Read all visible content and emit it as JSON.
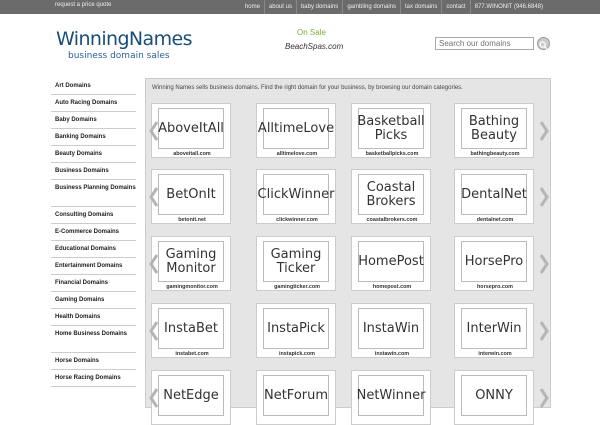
{
  "topbar": {
    "quote": "request a price quote",
    "nav": [
      "home",
      "about us",
      "baby domains",
      "gambling domains",
      "tax domains",
      "contact",
      "877.WINONIT (946.6848)"
    ]
  },
  "logo": {
    "name": "WinningNames",
    "tagline": "business domain sales"
  },
  "on_sale": {
    "label": "On Sale",
    "domain": "BeachSpas.com"
  },
  "search": {
    "placeholder": "Search our domains",
    "icon": "search-icon"
  },
  "sidebar": {
    "items": [
      "Art Domains",
      "Auto Racing Domains",
      "Baby Domains",
      "Banking Domains",
      "Beauty Domains",
      "Business Domains",
      "Business Planning Domains",
      "Consulting Domains",
      "E-Commerce Domains",
      "Educational Domains",
      "Entertainment Domains",
      "Financial Domains",
      "Gaming Domains",
      "Health Domains",
      "Home Business Domains",
      "Horse Domains",
      "Horse Racing Domains"
    ]
  },
  "intro": "Winning Names sells business domains. Find the right domain for your business, by browsing our domain categories.",
  "rows": [
    [
      {
        "logo": [
          "AboveItAll"
        ],
        "domain": "aboveitall.com"
      },
      {
        "logo": [
          "AlltimeLove"
        ],
        "domain": "alltimelove.com"
      },
      {
        "logo": [
          "Basketball",
          "Picks"
        ],
        "domain": "basketballpicks.com"
      },
      {
        "logo": [
          "Bathing",
          "Beauty"
        ],
        "domain": "bathingbeauty.com"
      }
    ],
    [
      {
        "logo": [
          "BetOnIt"
        ],
        "domain": "betonit.net"
      },
      {
        "logo": [
          "ClickWinner"
        ],
        "domain": "clickwinner.com"
      },
      {
        "logo": [
          "Coastal",
          "Brokers"
        ],
        "domain": "coastalbrokers.com"
      },
      {
        "logo": [
          "DentalNet"
        ],
        "domain": "dentalnet.com"
      }
    ],
    [
      {
        "logo": [
          "Gaming",
          "Monitor"
        ],
        "domain": "gamingmonitor.com"
      },
      {
        "logo": [
          "Gaming",
          "Ticker"
        ],
        "domain": "gamingticker.com"
      },
      {
        "logo": [
          "HomePost"
        ],
        "domain": "homepost.com"
      },
      {
        "logo": [
          "HorsePro"
        ],
        "domain": "horsepro.com"
      }
    ],
    [
      {
        "logo": [
          "InstaBet"
        ],
        "domain": "instabet.com"
      },
      {
        "logo": [
          "InstaPick"
        ],
        "domain": "instapick.com"
      },
      {
        "logo": [
          "InstaWin"
        ],
        "domain": "instawin.com"
      },
      {
        "logo": [
          "InterWin"
        ],
        "domain": "interwin.com"
      }
    ],
    [
      {
        "logo": [
          "NetEdge"
        ],
        "domain": ""
      },
      {
        "logo": [
          "NetForum"
        ],
        "domain": ""
      },
      {
        "logo": [
          "NetWinner"
        ],
        "domain": ""
      },
      {
        "logo": [
          "ONNY"
        ],
        "domain": ""
      }
    ]
  ],
  "colors": {
    "topbar": "#6b6b6b",
    "brand": "#1a4d7a",
    "sale": "#7fae3e",
    "panel": "#e5e5e5"
  }
}
